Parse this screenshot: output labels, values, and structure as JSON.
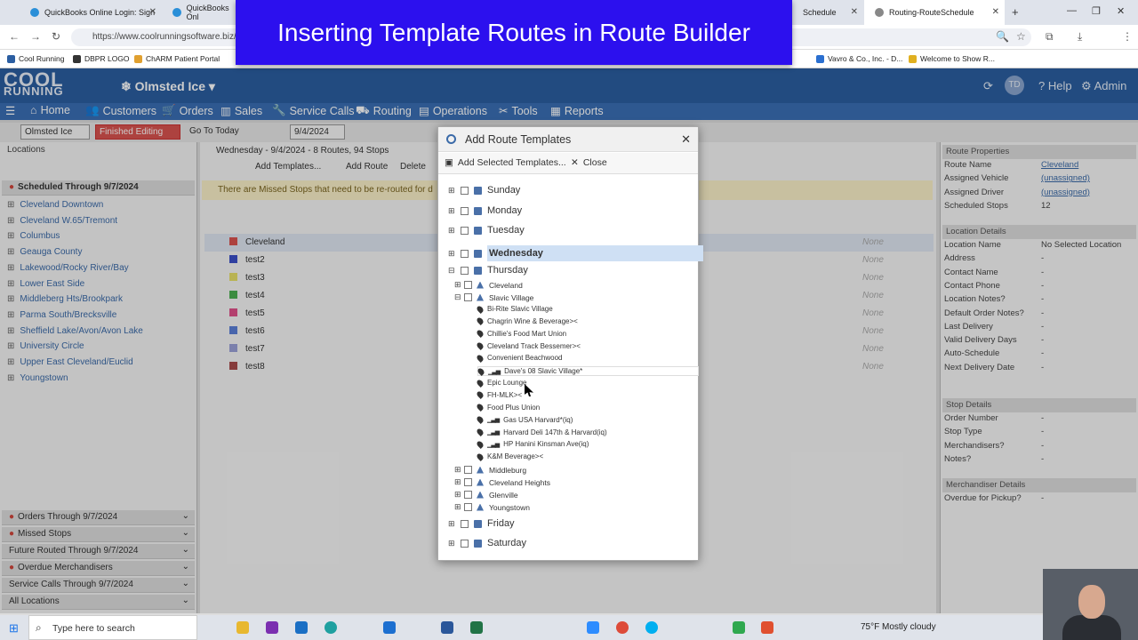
{
  "browser": {
    "tabs": [
      {
        "label": "QuickBooks Online Login: Sign"
      },
      {
        "label": "QuickBooks Onl"
      },
      {
        "label": "Schedule"
      },
      {
        "label": "Routing-RouteSchedule"
      }
    ],
    "url": "https://www.coolrunningsoftware.biz/V",
    "bookmarks": [
      "Cool Running",
      "DBPR LOGO",
      "ChARM Patient Portal",
      "Vavro & Co., Inc. - D...",
      "Welcome to Show R..."
    ]
  },
  "banner": {
    "text": "Inserting Template Routes in Route Builder"
  },
  "app": {
    "logo_line1": "COOL",
    "logo_line2": "RUNNING",
    "company": "Olmsted Ice",
    "user_initials": "TD",
    "help": "Help",
    "admin": "Admin",
    "menu": [
      "Home",
      "Customers",
      "Orders",
      "Sales",
      "Service Calls",
      "Routing",
      "Operations",
      "Tools",
      "Reports"
    ]
  },
  "toolbar": {
    "company_select": "Olmsted Ice",
    "finished_editing": "Finished Editing",
    "go_to_today": "Go To Today",
    "date": "9/4/2024"
  },
  "left_panel": {
    "title": "Locations",
    "scheduled_header": "Scheduled Through 9/7/2024",
    "locations": [
      "Cleveland Downtown",
      "Cleveland W.65/Tremont",
      "Columbus",
      "Geauga County",
      "Lakewood/Rocky River/Bay",
      "Lower East Side",
      "Middleberg Hts/Brookpark",
      "Parma South/Brecksville",
      "Sheffield Lake/Avon/Avon Lake",
      "University Circle",
      "Upper East Cleveland/Euclid",
      "Youngstown"
    ],
    "bottom_sections": [
      "Orders Through 9/7/2024",
      "Missed Stops",
      "Future Routed Through 9/7/2024",
      "Overdue Merchandisers",
      "Service Calls Through 9/7/2024",
      "All Locations"
    ]
  },
  "center": {
    "header": "Wednesday - 9/4/2024 - 8 Routes, 94 Stops",
    "add_templates": "Add Templates...",
    "add_route": "Add Route",
    "delete": "Delete",
    "missed_notice": "There are Missed Stops that need to be re-routed for d",
    "routes": [
      {
        "name": "Cleveland",
        "color": "#d9534f"
      },
      {
        "name": "test2",
        "color": "#3b4fc8"
      },
      {
        "name": "test3",
        "color": "#e8e06a"
      },
      {
        "name": "test4",
        "color": "#4caf50"
      },
      {
        "name": "test5",
        "color": "#e0508a"
      },
      {
        "name": "test6",
        "color": "#5a7fd8"
      },
      {
        "name": "test7",
        "color": "#9aa0d8"
      },
      {
        "name": "test8",
        "color": "#a84a4a"
      }
    ],
    "none_label": "None"
  },
  "right_panel": {
    "route_properties": "Route Properties",
    "route_rows": [
      {
        "k": "Route Name",
        "v": "Cleveland",
        "link": true
      },
      {
        "k": "Assigned Vehicle",
        "v": "(unassigned)",
        "link": true
      },
      {
        "k": "Assigned Driver",
        "v": "(unassigned)",
        "link": true
      },
      {
        "k": "Scheduled Stops",
        "v": "12",
        "link": false
      }
    ],
    "location_details": "Location Details",
    "location_rows": [
      {
        "k": "Location Name",
        "v": "No Selected Location"
      },
      {
        "k": "Address",
        "v": "-"
      },
      {
        "k": "Contact Name",
        "v": "-"
      },
      {
        "k": "Contact Phone",
        "v": "-"
      },
      {
        "k": "Location Notes?",
        "v": "-"
      },
      {
        "k": "Default Order Notes?",
        "v": "-"
      },
      {
        "k": "Last Delivery",
        "v": "-"
      },
      {
        "k": "Valid Delivery Days",
        "v": "-"
      },
      {
        "k": "Auto-Schedule",
        "v": "-"
      },
      {
        "k": "Next Delivery Date",
        "v": "-"
      }
    ],
    "stop_details": "Stop Details",
    "stop_rows": [
      {
        "k": "Order Number",
        "v": "-"
      },
      {
        "k": "Stop Type",
        "v": "-"
      },
      {
        "k": "Merchandisers?",
        "v": "-"
      },
      {
        "k": "Notes?",
        "v": "-"
      }
    ],
    "merch_details": "Merchandiser Details",
    "merch_rows": [
      {
        "k": "Overdue for Pickup?",
        "v": "-"
      }
    ]
  },
  "dialog": {
    "title": "Add Route Templates",
    "add_selected": "Add Selected Templates...",
    "close": "Close",
    "days": [
      "Sunday",
      "Monday",
      "Tuesday",
      "Wednesday",
      "Thursday",
      "Friday",
      "Saturday"
    ],
    "thursday_routes_top": [
      "Cleveland",
      "Slavic Village"
    ],
    "slavic_stops": [
      {
        "name": "Bi-Rite Slavic Village",
        "icon": "pin"
      },
      {
        "name": "Chagrin Wine & Beverage><",
        "icon": "pin"
      },
      {
        "name": "Chillie's Food Mart Union",
        "icon": "pin"
      },
      {
        "name": "Cleveland Track Bessemer><",
        "icon": "pin"
      },
      {
        "name": "Convenient Beachwood",
        "icon": "pin"
      },
      {
        "name": "Dave's 08 Slavic Village*",
        "icon": "signal"
      },
      {
        "name": "Epic Lounge",
        "icon": "pin"
      },
      {
        "name": "FH-MLK><",
        "icon": "pin"
      },
      {
        "name": "Food Plus Union",
        "icon": "pin"
      },
      {
        "name": "Gas USA Harvard*(iq)",
        "icon": "signal"
      },
      {
        "name": "Harvard Deli 147th & Harvard(iq)",
        "icon": "signal"
      },
      {
        "name": "HP Hanini Kinsman Ave(iq)",
        "icon": "signal"
      },
      {
        "name": "K&M Beverage><",
        "icon": "pin"
      }
    ],
    "thursday_routes_bottom": [
      "Middleburg",
      "Cleveland Heights",
      "Glenville",
      "Youngstown"
    ]
  },
  "taskbar": {
    "search_placeholder": "Type here to search",
    "weather": "75°F  Mostly cloudy"
  }
}
